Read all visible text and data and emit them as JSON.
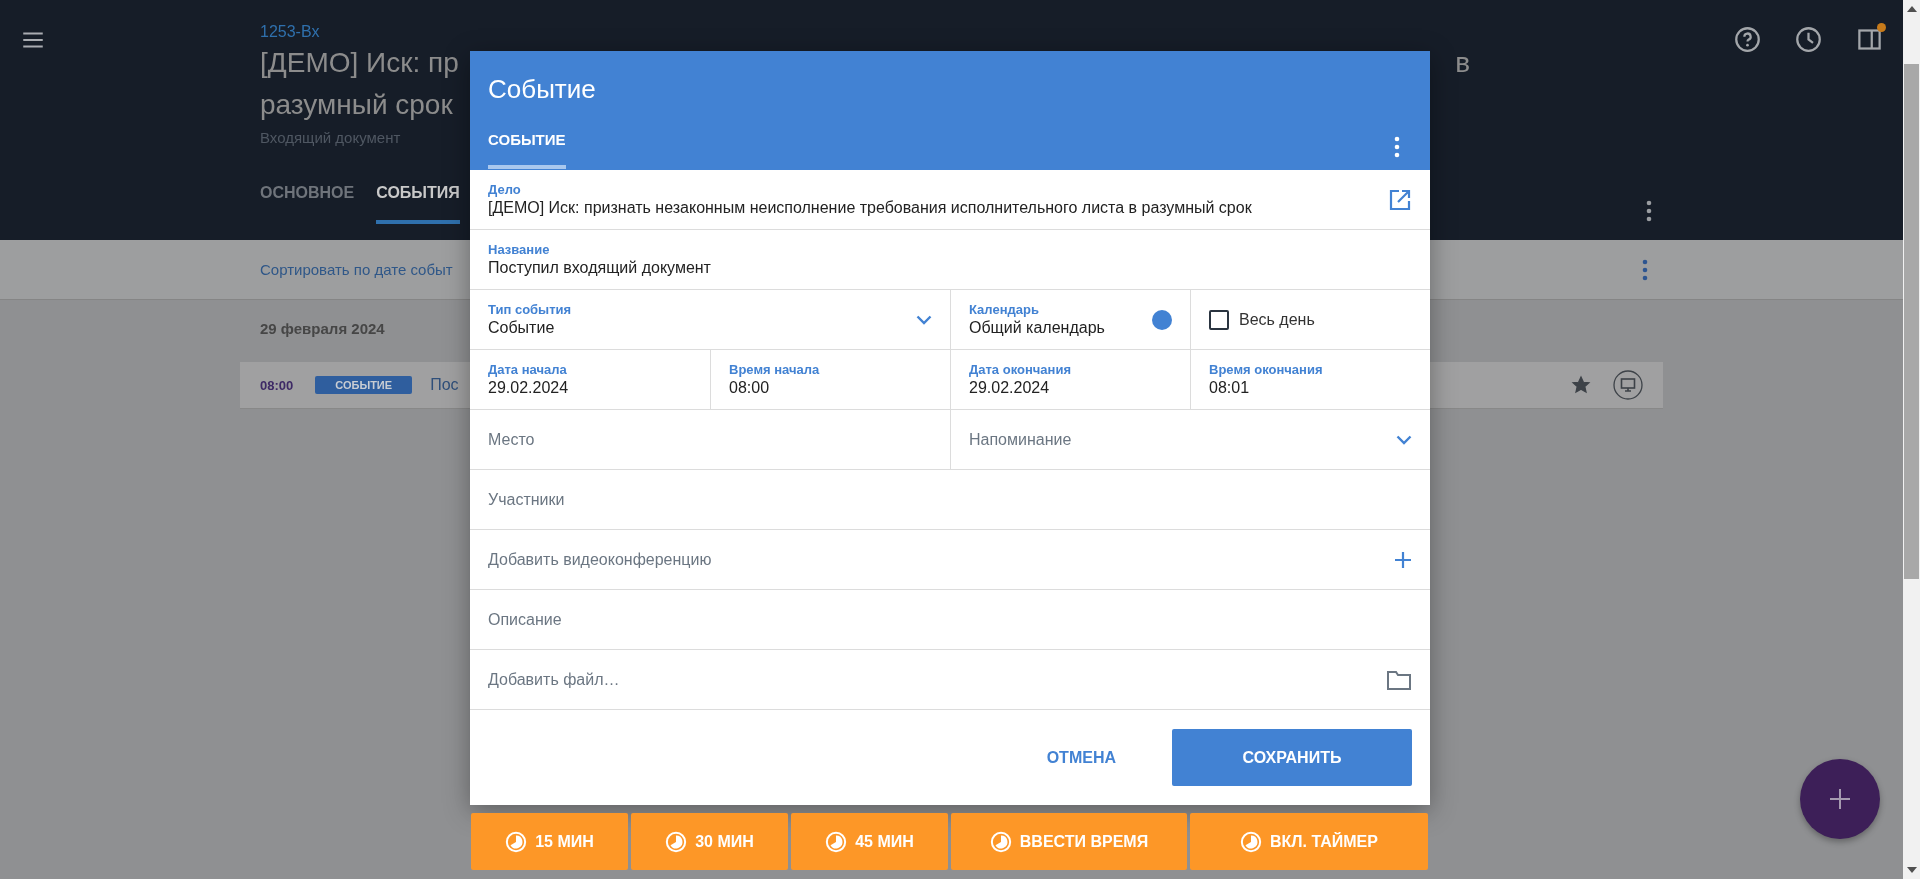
{
  "app_bar": {
    "case_number": "1253-Вх",
    "title_start": "[ДЕМО] Иск: пр",
    "title_end": "в",
    "title_line2": "разумный срок",
    "subtitle": "Входящий документ",
    "tabs": [
      {
        "label": "ОСНОВНОЕ",
        "selected": false
      },
      {
        "label": "СОБЫТИЯ",
        "selected": true
      }
    ],
    "notification_dot": true
  },
  "sort_bar": {
    "label": "Сортировать по дате событ"
  },
  "events": {
    "date": "29 февраля 2024",
    "rows": [
      {
        "time": "08:00",
        "type": "СОБЫТИЕ",
        "title": "Пос",
        "starred": true
      }
    ]
  },
  "dialog": {
    "title": "Событие",
    "tabs": [
      {
        "label": "СОБЫТИЕ",
        "selected": true
      }
    ],
    "rows": [
      [
        {
          "kind": "link",
          "label": "Дело",
          "value": "[ДЕМО] Иск: признать незаконным неисполнение требования исполнительного листа в разумный срок"
        }
      ],
      [
        {
          "kind": "field",
          "label": "Название",
          "value": "Поступил входящий документ"
        }
      ],
      [
        {
          "kind": "select",
          "label": "Тип события",
          "value": "Событие"
        },
        "",
        {
          "kind": "calendar",
          "label": "Календарь",
          "value": "Общий календарь",
          "color": "#4282d3"
        },
        {
          "kind": "checkbox",
          "label": "Весь день",
          "checked": false
        }
      ],
      [
        {
          "kind": "field",
          "label": "Дата начала",
          "value": "29.02.2024"
        },
        {
          "kind": "field",
          "label": "Время начала",
          "value": "08:00"
        },
        {
          "kind": "field",
          "label": "Дата окончания",
          "value": "29.02.2024"
        },
        {
          "kind": "field",
          "label": "Время окончания",
          "value": "08:01"
        }
      ],
      [
        {
          "kind": "empty",
          "placeholder": "Место"
        },
        "",
        {
          "kind": "select",
          "placeholder": "Напоминание"
        },
        ""
      ],
      [
        {
          "kind": "empty",
          "placeholder": "Участники"
        }
      ],
      [
        {
          "kind": "add",
          "placeholder": "Добавить видеоконференцию"
        }
      ],
      [
        {
          "kind": "empty",
          "placeholder": "Описание"
        }
      ],
      [
        {
          "kind": "file",
          "placeholder": "Добавить файл…"
        }
      ]
    ],
    "buttons": {
      "cancel": "ОТМЕНА",
      "save": "СОХРАНИТЬ"
    }
  },
  "timer_buttons": [
    "15 МИН",
    "30 МИН",
    "45 МИН",
    "ВВЕСТИ ВРЕМЯ",
    "ВКЛ. ТАЙМЕР"
  ]
}
